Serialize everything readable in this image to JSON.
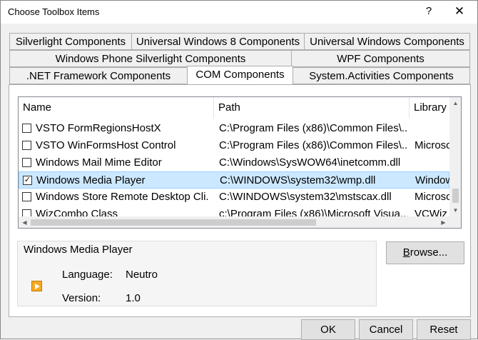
{
  "window": {
    "title": "Choose Toolbox Items",
    "help_glyph": "?",
    "close_glyph": "✕"
  },
  "tabs": {
    "row1": [
      "Silverlight Components",
      "Universal Windows 8 Components",
      "Universal Windows Components"
    ],
    "row2": [
      "Windows Phone Silverlight Components",
      "WPF Components"
    ],
    "row3": [
      ".NET Framework Components",
      "COM Components",
      "System.Activities Components"
    ],
    "active": "COM Components"
  },
  "list": {
    "columns": [
      "Name",
      "Path",
      "Library"
    ],
    "rows": [
      {
        "checked": false,
        "name": "VSTO FormRegionsHostX",
        "path": "C:\\Program Files (x86)\\Common Files\\...",
        "library": ""
      },
      {
        "checked": false,
        "name": "VSTO WinFormsHost Control",
        "path": "C:\\Program Files (x86)\\Common Files\\...",
        "library": "Microsc"
      },
      {
        "checked": false,
        "name": "Windows Mail Mime Editor",
        "path": "C:\\Windows\\SysWOW64\\inetcomm.dll",
        "library": ""
      },
      {
        "checked": true,
        "name": "Windows Media Player",
        "path": "C:\\WINDOWS\\system32\\wmp.dll",
        "library": "Window"
      },
      {
        "checked": false,
        "name": "Windows Store Remote Desktop Cli...",
        "path": "C:\\WINDOWS\\system32\\mstscax.dll",
        "library": "Microsc"
      },
      {
        "checked": false,
        "name": "WizCombo Class",
        "path": "c:\\Program Files (x86)\\Microsoft Visua...",
        "library": "VCWiz"
      }
    ],
    "selected_index": 3,
    "check_glyph": "✓"
  },
  "details": {
    "title": "Windows Media Player",
    "language_label": "Language:",
    "language_value": "Neutro",
    "version_label": "Version:",
    "version_value": "1.0",
    "icon": "media-player-icon"
  },
  "buttons": {
    "browse_prefix": "",
    "browse_underlined": "B",
    "browse_rest": "rowse...",
    "ok": "OK",
    "cancel": "Cancel",
    "reset": "Reset"
  },
  "colors": {
    "selection": "#cce8ff",
    "selection_border": "#99d1ff",
    "dialog_bg": "#f0f0f0"
  }
}
